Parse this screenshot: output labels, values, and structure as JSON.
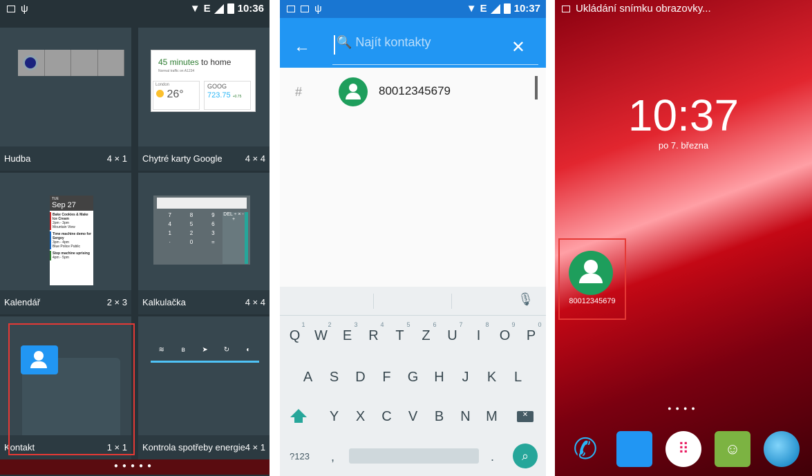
{
  "panel1": {
    "status": {
      "time": "10:36",
      "network": "E"
    },
    "widgets": [
      {
        "name": "Hudba",
        "size": "4 × 1"
      },
      {
        "name": "Chytré karty Google",
        "size": "4 × 4"
      },
      {
        "name": "Kalendář",
        "size": "2 × 3"
      },
      {
        "name": "Kalkulačka",
        "size": "4 × 4"
      },
      {
        "name": "Kontakt",
        "size": "1 × 1"
      },
      {
        "name": "Kontrola spotřeby energie",
        "size": "4 × 1"
      }
    ],
    "google_card": {
      "headline_bold": "45 minutes",
      "headline_rest": " to home",
      "sub": "Normal traffic on A1234",
      "city": "London",
      "temp": "26°",
      "ticker": "GOOG",
      "price": "723.75",
      "change": "+0.75"
    },
    "calendar": {
      "day": "TUE",
      "date": "Sep 27",
      "events": [
        "Bake Cookies & Make Ice Cream",
        "2pm - 3pm",
        "Mountain View",
        "Time machine demo for Sergey",
        "3pm - 4pm",
        "Blue Police Public",
        "Stop machine uprising",
        "4pm - 5pm"
      ]
    },
    "calc_keys": [
      "7",
      "8",
      "9",
      "4",
      "5",
      "6",
      "1",
      "2",
      "3",
      "·",
      "0",
      "="
    ],
    "calc_ops": "DEL ÷ × - +"
  },
  "panel2": {
    "status": {
      "time": "10:37",
      "network": "E"
    },
    "search_placeholder": "Najít kontakty",
    "index_letter": "#",
    "contact_number": "80012345679",
    "kb_row1": [
      "Q",
      "W",
      "E",
      "R",
      "T",
      "Z",
      "U",
      "I",
      "O",
      "P"
    ],
    "kb_row1_nums": [
      "1",
      "2",
      "3",
      "4",
      "5",
      "6",
      "7",
      "8",
      "9",
      "0"
    ],
    "kb_row2": [
      "A",
      "S",
      "D",
      "F",
      "G",
      "H",
      "J",
      "K",
      "L"
    ],
    "kb_row3": [
      "Y",
      "X",
      "C",
      "V",
      "B",
      "N",
      "M"
    ],
    "kb_symbols": "?123",
    "kb_comma": ",",
    "kb_period": "."
  },
  "panel3": {
    "status_text": "Ukládání snímku obrazovky...",
    "clock": "10:37",
    "date": "po 7. března",
    "shortcut_label": "80012345679"
  },
  "colors": {
    "accent_blue": "#2196f3",
    "contact_green": "#1e9e5c",
    "highlight_red": "#e53935",
    "teal": "#26a69a"
  }
}
